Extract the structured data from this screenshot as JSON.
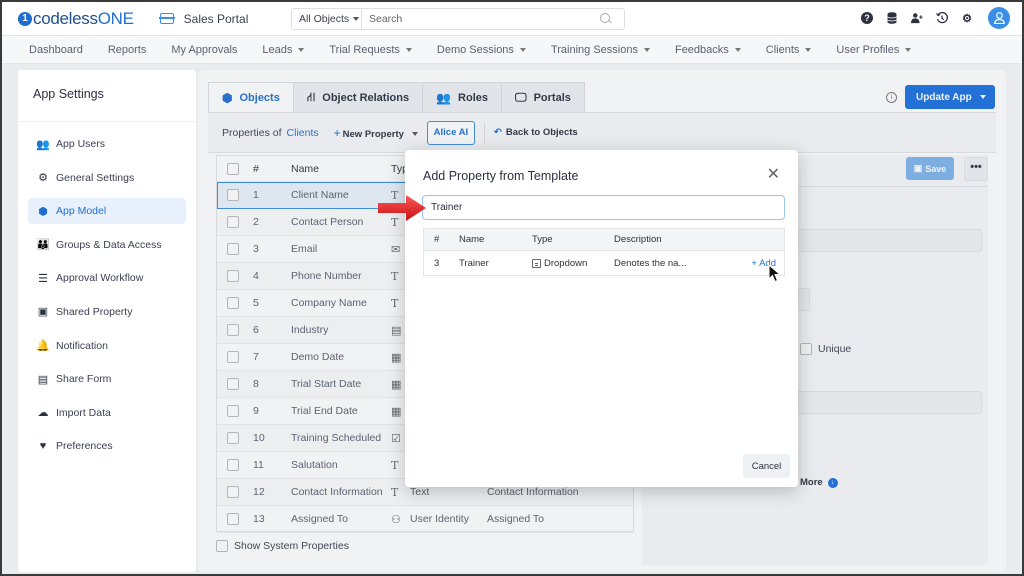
{
  "header": {
    "logo_mark": "1",
    "logo_text_a": "codeless",
    "logo_text_b": "ONE",
    "portal_name": "Sales Portal",
    "search_scope": "All Objects",
    "search_placeholder": "Search",
    "icons": [
      "help-icon",
      "database-icon",
      "add-user-icon",
      "history-icon",
      "gear-icon",
      "user-avatar"
    ]
  },
  "nav": {
    "items": [
      {
        "label": "Dashboard",
        "dropdown": false
      },
      {
        "label": "Reports",
        "dropdown": false
      },
      {
        "label": "My Approvals",
        "dropdown": false
      },
      {
        "label": "Leads",
        "dropdown": true
      },
      {
        "label": "Trial Requests",
        "dropdown": true
      },
      {
        "label": "Demo Sessions",
        "dropdown": true
      },
      {
        "label": "Training Sessions",
        "dropdown": true
      },
      {
        "label": "Feedbacks",
        "dropdown": true
      },
      {
        "label": "Clients",
        "dropdown": true
      },
      {
        "label": "User Profiles",
        "dropdown": true
      }
    ]
  },
  "sidebar": {
    "title": "App Settings",
    "items": [
      {
        "label": "App Users",
        "icon": "users-icon",
        "glyph": "👥",
        "active": false
      },
      {
        "label": "General Settings",
        "icon": "gear-icon",
        "glyph": "⚙",
        "active": false
      },
      {
        "label": "App Model",
        "icon": "cube-icon",
        "glyph": "⬢",
        "active": true
      },
      {
        "label": "Groups & Data Access",
        "icon": "group-icon",
        "glyph": "👪",
        "active": false
      },
      {
        "label": "Approval Workflow",
        "icon": "checklist-icon",
        "glyph": "☰",
        "active": false
      },
      {
        "label": "Shared Property",
        "icon": "shared-property-icon",
        "glyph": "▣",
        "active": false
      },
      {
        "label": "Notification",
        "icon": "bell-icon",
        "glyph": "🔔",
        "active": false
      },
      {
        "label": "Share Form",
        "icon": "form-icon",
        "glyph": "▤",
        "active": false
      },
      {
        "label": "Import Data",
        "icon": "cloud-upload-icon",
        "glyph": "☁",
        "active": false
      },
      {
        "label": "Preferences",
        "icon": "hand-heart-icon",
        "glyph": "♥",
        "active": false
      }
    ]
  },
  "main": {
    "tabs": [
      {
        "label": "Objects",
        "icon": "cube-icon",
        "glyph": "⬢",
        "active": true
      },
      {
        "label": "Object Relations",
        "icon": "relations-icon",
        "glyph": "⛙",
        "active": false
      },
      {
        "label": "Roles",
        "icon": "users-icon",
        "glyph": "👥",
        "active": false
      },
      {
        "label": "Portals",
        "icon": "monitor-icon",
        "glyph": "🖵",
        "active": false
      }
    ],
    "update_label": "Update App",
    "toolbar": {
      "properties_of": "Properties of",
      "object_name": "Clients",
      "new_property": "New Property",
      "alice_ai": "Alice AI",
      "back": "Back to Objects"
    },
    "table": {
      "headers": {
        "num": "#",
        "name": "Name",
        "type": "Type"
      },
      "rows": [
        {
          "num": "1",
          "name": "Client Name",
          "type_glyph": "T",
          "type": "",
          "label": "",
          "selected": true
        },
        {
          "num": "2",
          "name": "Contact Person",
          "type_glyph": "T",
          "type": "",
          "label": ""
        },
        {
          "num": "3",
          "name": "Email",
          "type_glyph": "✉",
          "type": "",
          "label": ""
        },
        {
          "num": "4",
          "name": "Phone Number",
          "type_glyph": "T",
          "type": "",
          "label": ""
        },
        {
          "num": "5",
          "name": "Company Name",
          "type_glyph": "T",
          "type": "",
          "label": ""
        },
        {
          "num": "6",
          "name": "Industry",
          "type_glyph": "▤",
          "type": "",
          "label": ""
        },
        {
          "num": "7",
          "name": "Demo Date",
          "type_glyph": "▦",
          "type": "",
          "label": ""
        },
        {
          "num": "8",
          "name": "Trial Start Date",
          "type_glyph": "▦",
          "type": "",
          "label": ""
        },
        {
          "num": "9",
          "name": "Trial End Date",
          "type_glyph": "▦",
          "type": "",
          "label": ""
        },
        {
          "num": "10",
          "name": "Training Scheduled",
          "type_glyph": "☑",
          "type": "",
          "label": ""
        },
        {
          "num": "11",
          "name": "Salutation",
          "type_glyph": "T",
          "type": "",
          "label": ""
        },
        {
          "num": "12",
          "name": "Contact Information",
          "type_glyph": "T",
          "type": "Text",
          "label": "Contact Information"
        },
        {
          "num": "13",
          "name": "Assigned To",
          "type_glyph": "⚇",
          "type": "User Identity",
          "label": "Assigned To"
        }
      ]
    },
    "show_system": "Show System Properties",
    "right_panel": {
      "save_label": "Save",
      "more_label": "•••",
      "unique_label": "Unique",
      "show_more": "Show More"
    }
  },
  "modal": {
    "title": "Add Property from Template",
    "search_value": "Trainer",
    "headers": {
      "num": "#",
      "name": "Name",
      "type": "Type",
      "description": "Description"
    },
    "rows": [
      {
        "num": "3",
        "name": "Trainer",
        "type": "Dropdown",
        "description": "Denotes the na...",
        "action": "+ Add"
      }
    ],
    "cancel": "Cancel"
  }
}
